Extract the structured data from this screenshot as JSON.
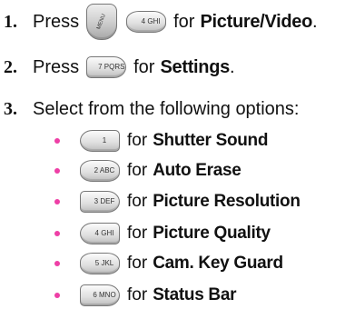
{
  "steps": [
    {
      "number": "1.",
      "press": "Press",
      "keys": [
        {
          "name": "menu-ok-key",
          "label": "MENU",
          "shape": "tall"
        },
        {
          "name": "key-4",
          "label": "4 GHI",
          "shape": "std"
        }
      ],
      "for_text": "for",
      "target": "Picture/Video",
      "end": "."
    },
    {
      "number": "2.",
      "press": "Press",
      "keys": [
        {
          "name": "key-7",
          "label": "7 PQRS",
          "shape": "right"
        }
      ],
      "for_text": "for",
      "target": "Settings",
      "end": "."
    },
    {
      "number": "3.",
      "text": "Select from the following options:"
    }
  ],
  "options": [
    {
      "key_label": "1",
      "shape": "left",
      "for_text": "for",
      "label": "Shutter Sound"
    },
    {
      "key_label": "2 ABC",
      "shape": "std",
      "for_text": "for",
      "label": "Auto Erase"
    },
    {
      "key_label": "3 DEF",
      "shape": "right",
      "for_text": "for",
      "label": "Picture Resolution"
    },
    {
      "key_label": "4 GHI",
      "shape": "left",
      "for_text": "for",
      "label": "Picture Quality"
    },
    {
      "key_label": "5 JKL",
      "shape": "std",
      "for_text": "for",
      "label": "Cam. Key Guard"
    },
    {
      "key_label": "6 MNO",
      "shape": "right",
      "for_text": "for",
      "label": "Status Bar"
    }
  ],
  "colors": {
    "bullet": "#ee3fa6",
    "text": "#111111"
  }
}
